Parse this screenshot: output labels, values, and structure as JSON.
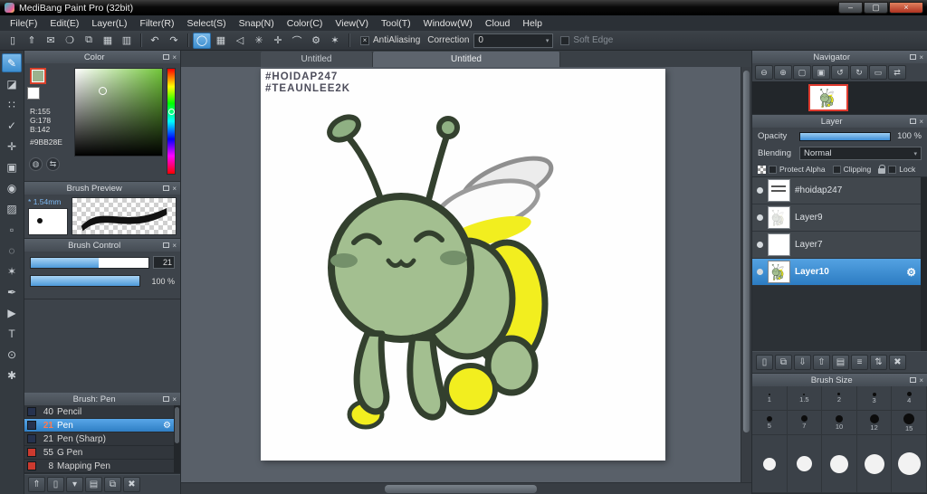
{
  "titlebar": {
    "title": "MediBang Paint Pro (32bit)",
    "minimize": "–",
    "maximize": "▢",
    "close": "×"
  },
  "menu": {
    "items": [
      "File(F)",
      "Edit(E)",
      "Layer(L)",
      "Filter(R)",
      "Select(S)",
      "Snap(N)",
      "Color(C)",
      "View(V)",
      "Tool(T)",
      "Window(W)",
      "Cloud",
      "Help"
    ]
  },
  "toolbar": {
    "antialiasing_label": "AntiAliasing",
    "correction_label": "Correction",
    "correction_value": "0",
    "soft_edge_label": "Soft Edge"
  },
  "icons": {
    "undo": "↶",
    "redo": "↷",
    "file_new": "▯",
    "file_save": "⇑",
    "file_export": "✉",
    "file_palette": "❍",
    "file_pages": "⧉",
    "file_grid": "▦",
    "file_table": "▥",
    "brush_mode": "◯",
    "snap_grid": "▦",
    "snap_off": "◁",
    "snap_parallel": "✳",
    "snap_cross": "✛",
    "snap_curve": "⌒",
    "snap_vanish": "⚙",
    "snap_radial": "✶",
    "tool_brush": "✎",
    "tool_eraser": "◪",
    "tool_dot": "∷",
    "tool_selectpen": "✓",
    "tool_move": "✛",
    "tool_fillrect": "▣",
    "tool_bucket": "◉",
    "tool_gradient": "▨",
    "tool_select": "▫",
    "tool_lasso": "◌",
    "tool_wand": "✶",
    "tool_pen": "✒",
    "tool_operation": "▶",
    "tool_text": "T",
    "tool_eyedrop": "⊙",
    "tool_hand": "✱",
    "btn_up": "⇑",
    "btn_new": "▯",
    "btn_menu": "▾",
    "btn_folder": "▤",
    "btn_copy": "⧉",
    "btn_trash": "✖",
    "nav_zoomout": "⊖",
    "nav_zoomin": "⊕",
    "nav_fit": "▢",
    "nav_actual": "▣",
    "nav_rotl": "↺",
    "nav_rotr": "↻",
    "nav_reset": "▭",
    "nav_flip": "⇄",
    "layer_new": "▯",
    "layer_dup": "⧉",
    "layer_down": "⇩",
    "layer_up": "⇧",
    "layer_folder": "▤",
    "layer_merge": "≡",
    "layer_swap": "⇅",
    "layer_trash": "✖",
    "gear": "⚙",
    "dropdown_arrow": "▾",
    "check_mark": "×",
    "globe": "◍",
    "swap": "⇆"
  },
  "left_panels": {
    "color": {
      "title": "Color",
      "r": "R:155",
      "g": "G:178",
      "b": "B:142",
      "hex": "#9BB28E"
    },
    "brush_preview": {
      "title": "Brush Preview",
      "marker": "*",
      "size": "1.54mm"
    },
    "brush_control": {
      "title": "Brush Control",
      "rows": [
        {
          "value": "21"
        },
        {
          "value": "100 %"
        }
      ]
    },
    "brush_list": {
      "title": "Brush: Pen",
      "items": [
        {
          "size": "40",
          "name": "Pencil"
        },
        {
          "size": "21",
          "name": "Pen"
        },
        {
          "size": "21",
          "name": "Pen (Sharp)"
        },
        {
          "size": "55",
          "name": "G Pen"
        },
        {
          "size": "8",
          "name": "Mapping Pen"
        }
      ]
    }
  },
  "canvas": {
    "tabs": [
      "Untitled",
      "Untitled"
    ],
    "hashtags": [
      "#HOIDAP247",
      "#TEAUNLEE2K"
    ]
  },
  "navigator": {
    "title": "Navigator"
  },
  "layer_panel": {
    "title": "Layer",
    "opacity_label": "Opacity",
    "opacity_value": "100 %",
    "blending_label": "Blending",
    "blending_value": "Normal",
    "protect_alpha": "Protect Alpha",
    "clipping": "Clipping",
    "lock": "Lock",
    "layers": [
      {
        "name": "#hoidap247"
      },
      {
        "name": "Layer9"
      },
      {
        "name": "Layer7"
      },
      {
        "name": "Layer10"
      }
    ]
  },
  "brush_size": {
    "title": "Brush Size",
    "row1": [
      "1",
      "1.5",
      "2",
      "3",
      "4"
    ],
    "row2": [
      "5",
      "7",
      "10",
      "12",
      "15"
    ]
  },
  "colors": {
    "accent": "#3f97e0",
    "selected_color": "#9BB28E",
    "yellow": "#f2ee1f",
    "green": "#a3bf90"
  }
}
